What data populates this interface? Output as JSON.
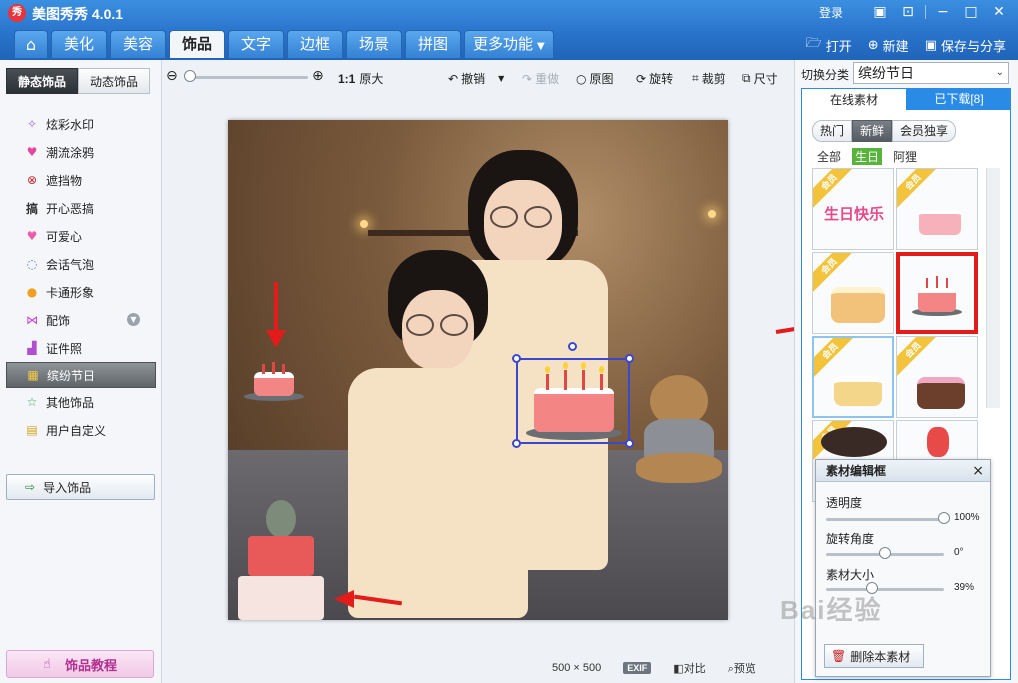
{
  "app": {
    "icon_text": "秀",
    "title": "美图秀秀 4.0.1",
    "login": "登录"
  },
  "tabs": [
    {
      "label": "⌂",
      "icon": "home-icon"
    },
    {
      "label": "美化"
    },
    {
      "label": "美容"
    },
    {
      "label": "饰品",
      "active": true
    },
    {
      "label": "文字"
    },
    {
      "label": "边框"
    },
    {
      "label": "场景"
    },
    {
      "label": "拼图"
    },
    {
      "label": "更多功能"
    }
  ],
  "top_actions": {
    "open": "打开",
    "new": "新建",
    "save": "保存与分享"
  },
  "left": {
    "subtabs": [
      "静态饰品",
      "动态饰品"
    ],
    "categories": [
      {
        "label": "炫彩水印",
        "icon": "sparkle-icon"
      },
      {
        "label": "潮流涂鸦",
        "icon": "lips-icon"
      },
      {
        "label": "遮挡物",
        "icon": "block-icon"
      },
      {
        "label": "开心恶搞",
        "icon": "fun-icon"
      },
      {
        "label": "可爱心",
        "icon": "heart-icon"
      },
      {
        "label": "会话气泡",
        "icon": "bubble-icon"
      },
      {
        "label": "卡通形象",
        "icon": "cartoon-icon"
      },
      {
        "label": "配饰",
        "icon": "bow-icon"
      },
      {
        "label": "证件照",
        "icon": "shirt-icon"
      },
      {
        "label": "缤纷节日",
        "icon": "gift-icon",
        "active": true
      },
      {
        "label": "其他饰品",
        "icon": "star-icon"
      },
      {
        "label": "用户自定义",
        "icon": "folder-icon"
      }
    ],
    "import_label": "导入饰品",
    "tutorial_label": "饰品教程"
  },
  "toolbar": {
    "ratio": "1:1",
    "orig_size": "原大",
    "undo": "撤销",
    "redo": "重做",
    "original": "原图",
    "rotate": "旋转",
    "crop": "裁剪",
    "resize": "尺寸"
  },
  "status": {
    "width": "500",
    "x": "×",
    "height": "500",
    "exif": "EXIF",
    "compare": "对比",
    "preview": "预览"
  },
  "right": {
    "switch_label": "切换分类",
    "switch_value": "缤纷节日",
    "tabs": [
      "在线素材",
      "已下载[8]"
    ],
    "filters": [
      "热门",
      "新鲜",
      "会员独享"
    ],
    "subfilters": [
      "全部",
      "生日",
      "阿狸"
    ],
    "thumbs": [
      {
        "vip": "会员",
        "text": "生日快乐"
      },
      {
        "vip": "会员"
      },
      {
        "vip": "会员"
      },
      {
        "vip": ""
      },
      {
        "vip": "会员"
      },
      {
        "vip": "会员"
      },
      {
        "vip": "会员"
      },
      {
        "vip": ""
      }
    ]
  },
  "editor": {
    "title": "素材编辑框",
    "opacity_label": "透明度",
    "opacity_value": "100%",
    "opacity": 1.0,
    "rotate_label": "旋转角度",
    "rotate_value": "0°",
    "rotate": 0.5,
    "size_label": "素材大小",
    "size_value": "39%",
    "size": 0.39,
    "delete_label": "删除本素材"
  },
  "watermark": "Bai经验"
}
